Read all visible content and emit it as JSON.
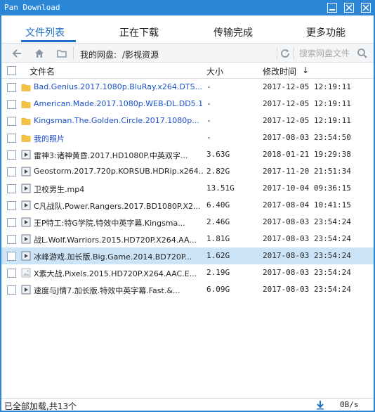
{
  "window": {
    "title": "Pan Download"
  },
  "tabs": [
    {
      "label": "文件列表",
      "active": true
    },
    {
      "label": "正在下载",
      "active": false
    },
    {
      "label": "传输完成",
      "active": false
    },
    {
      "label": "更多功能",
      "active": false
    }
  ],
  "toolbar": {
    "path_label": "我的网盘:",
    "path_value": "/影视资源",
    "search_placeholder": "搜索网盘文件"
  },
  "table": {
    "columns": {
      "name": "文件名",
      "size": "大小",
      "date": "修改时间"
    },
    "sort_indicator": "↓",
    "rows": [
      {
        "name": "Bad.Genius.2017.1080p.BluRay.x264.DTS...",
        "size": "-",
        "date": "2017-12-05 12:19:11",
        "type": "folder",
        "link": true,
        "selected": false
      },
      {
        "name": "American.Made.2017.1080p.WEB-DL.DD5.1...",
        "size": "-",
        "date": "2017-12-05 12:19:11",
        "type": "folder",
        "link": true,
        "selected": false
      },
      {
        "name": "Kingsman.The.Golden.Circle.2017.1080p...",
        "size": "-",
        "date": "2017-12-05 12:19:11",
        "type": "folder",
        "link": true,
        "selected": false
      },
      {
        "name": "我的照片",
        "size": "-",
        "date": "2017-08-03 23:54:50",
        "type": "folder",
        "link": true,
        "selected": false
      },
      {
        "name": "雷神3:诸神黄昏.2017.HD1080P.中英双字...",
        "size": "3.63G",
        "date": "2018-01-21 19:29:38",
        "type": "video",
        "link": false,
        "selected": false
      },
      {
        "name": "Geostorm.2017.720p.KORSUB.HDRip.x264...",
        "size": "2.82G",
        "date": "2017-11-20 21:51:34",
        "type": "video",
        "link": false,
        "selected": false
      },
      {
        "name": "卫校男生.mp4",
        "size": "13.51G",
        "date": "2017-10-04 09:36:15",
        "type": "video",
        "link": false,
        "selected": false
      },
      {
        "name": "C凡战队.Power.Rangers.2017.BD1080P.X2...",
        "size": "6.40G",
        "date": "2017-08-04 10:41:15",
        "type": "video",
        "link": false,
        "selected": false
      },
      {
        "name": "王P特工:特G学院.特效中英字幕.Kingsma...",
        "size": "2.46G",
        "date": "2017-08-03 23:54:24",
        "type": "video",
        "link": false,
        "selected": false
      },
      {
        "name": "战L.Wolf.Warriors.2015.HD720P.X264.AA...",
        "size": "1.81G",
        "date": "2017-08-03 23:54:24",
        "type": "video",
        "link": false,
        "selected": false
      },
      {
        "name": "冰峰游戏.加长版.Big.Game.2014.BD720P...",
        "size": "1.62G",
        "date": "2017-08-03 23:54:24",
        "type": "video",
        "link": false,
        "selected": true
      },
      {
        "name": "X素大战.Pixels.2015.HD720P.X264.AAC.E...",
        "size": "2.19G",
        "date": "2017-08-03 23:54:24",
        "type": "image",
        "link": false,
        "selected": false
      },
      {
        "name": "速度与J情7.加长版.特效中英字幕.Fast.&...",
        "size": "6.09G",
        "date": "2017-08-03 23:54:24",
        "type": "video",
        "link": false,
        "selected": false
      }
    ]
  },
  "status": {
    "text": "已全部加载,共13个",
    "speed": "0B/s"
  },
  "colors": {
    "titlebar": "#2b86d6",
    "accent": "#1a6fc9",
    "link": "#1a4fd1",
    "selected_row": "#cce4f7",
    "folder": "#f5c342"
  }
}
